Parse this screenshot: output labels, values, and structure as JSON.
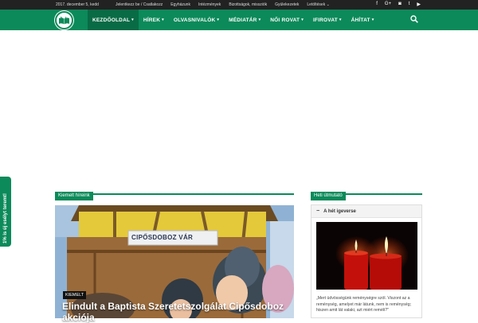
{
  "topbar": {
    "date": "2017. december 5, kedd",
    "links": [
      "Jelentkezz be / Csatlakozz",
      "Egyházunk",
      "Intézmények",
      "Bizottságok, missziók",
      "Gyülekezetek",
      "Letöltések"
    ],
    "social_icons": [
      "facebook-icon",
      "google-plus-icon",
      "instagram-icon",
      "twitter-icon",
      "youtube-icon"
    ]
  },
  "nav": {
    "items": [
      {
        "label": "KEZDŐOLDAL",
        "active": true
      },
      {
        "label": "HÍREK",
        "active": false
      },
      {
        "label": "OLVASNIVALÓK",
        "active": false
      },
      {
        "label": "MÉDIATÁR",
        "active": false
      },
      {
        "label": "NŐI ROVAT",
        "active": false
      },
      {
        "label": "IFIROVAT",
        "active": false
      },
      {
        "label": "ÁHÍTAT",
        "active": false
      }
    ],
    "search_icon": "search-icon"
  },
  "featured": {
    "section_title": "Kiemelt híreink",
    "badge": "KIEMELT",
    "sign_text": "CIPŐSDOBOZ VÁR",
    "headline": "Elindult a Baptista Szeretetszolgálat Cipősdoboz akciója"
  },
  "sidebar": {
    "section_title": "Heti útmutató",
    "widget_title": "A hét igeverse",
    "quote": "„Mert üdvösségünk reménységre szól. Viszont az a reménység, amelyet már látunk, nem is reménység; hiszen amit lát valaki, azt miért reméli?\""
  },
  "side_tab": {
    "label": "1% is új esélyt teremt!"
  },
  "colors": {
    "brand": "#0c8a5a",
    "topbar": "#222222",
    "active_nav": "#096b45"
  }
}
